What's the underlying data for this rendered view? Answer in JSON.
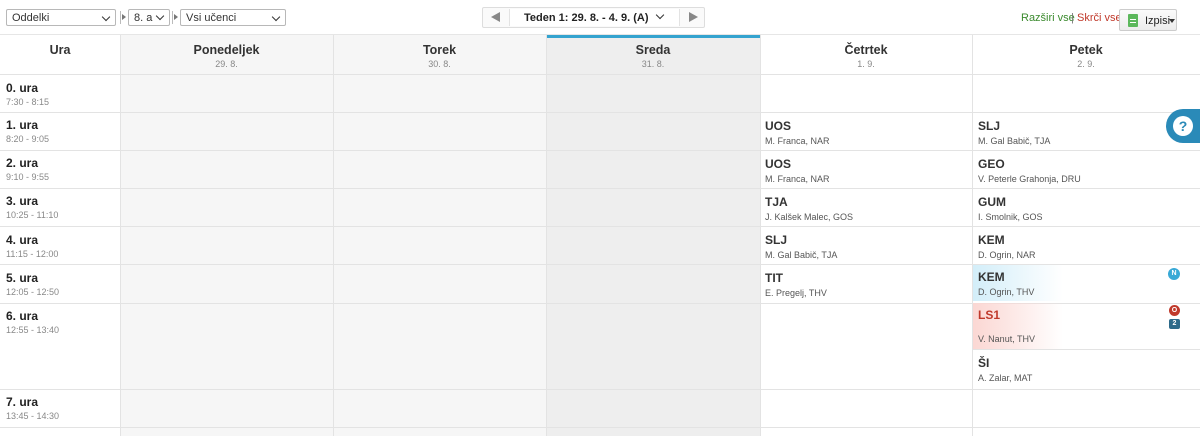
{
  "toolbar": {
    "group_select": "Oddelki",
    "class_select": "8. a",
    "student_select": "Vsi učenci",
    "week_label": "Teden 1: 29. 8. - 4. 9. (A)",
    "expand_all": "Razširi vse",
    "separator": "|",
    "collapse_all": "Skrči vse",
    "print_label": "Izpisi"
  },
  "header": {
    "ura_label": "Ura",
    "days": [
      {
        "name": "Ponedeljek",
        "date": "29. 8."
      },
      {
        "name": "Torek",
        "date": "30. 8."
      },
      {
        "name": "Sreda",
        "date": "31. 8."
      },
      {
        "name": "Četrtek",
        "date": "1. 9."
      },
      {
        "name": "Petek",
        "date": "2. 9."
      }
    ]
  },
  "periods": [
    {
      "name": "0. ura",
      "time": "7:30 - 8:15"
    },
    {
      "name": "1. ura",
      "time": "8:20 - 9:05"
    },
    {
      "name": "2. ura",
      "time": "9:10 - 9:55"
    },
    {
      "name": "3. ura",
      "time": "10:25 - 11:10"
    },
    {
      "name": "4. ura",
      "time": "11:15 - 12:00"
    },
    {
      "name": "5. ura",
      "time": "12:05 - 12:50"
    },
    {
      "name": "6. ura",
      "time": "12:55 - 13:40"
    },
    {
      "name": "7. ura",
      "time": "13:45 - 14:30"
    }
  ],
  "thursday": [
    {
      "subject": "UOS",
      "teacher": "M. Franca, NAR"
    },
    {
      "subject": "UOS",
      "teacher": "M. Franca, NAR"
    },
    {
      "subject": "TJA",
      "teacher": "J. Kalšek Malec, GOS"
    },
    {
      "subject": "SLJ",
      "teacher": "M. Gal Babič, TJA"
    },
    {
      "subject": "TIT",
      "teacher": "E. Pregelj, THV"
    }
  ],
  "friday": [
    {
      "subject": "SLJ",
      "teacher": "M. Gal Babič, TJA"
    },
    {
      "subject": "GEO",
      "teacher": "V. Peterle Grahonja, DRU"
    },
    {
      "subject": "GUM",
      "teacher": "I. Smolnik, GOS"
    },
    {
      "subject": "KEM",
      "teacher": "D. Ogrin, NAR"
    },
    {
      "subject": "KEM",
      "teacher": "D. Ogrin, THV",
      "badge": "N"
    },
    {
      "subject": "LS1",
      "teacher": "V. Nanut, THV",
      "badge": "O",
      "count": "2"
    },
    {
      "subject": "ŠI",
      "teacher": "A. Zalar, MAT"
    }
  ],
  "colors": {
    "accent": "#34a3cf",
    "new_badge": "#39a9d6",
    "alert": "#c0392b",
    "expand": "#3b8a2e",
    "help": "#2a8ab8"
  },
  "icons": {
    "help": "question-circle-icon",
    "print": "document-icon",
    "prev": "triangle-left-icon",
    "next": "triangle-right-icon"
  },
  "help_symbol": "?"
}
